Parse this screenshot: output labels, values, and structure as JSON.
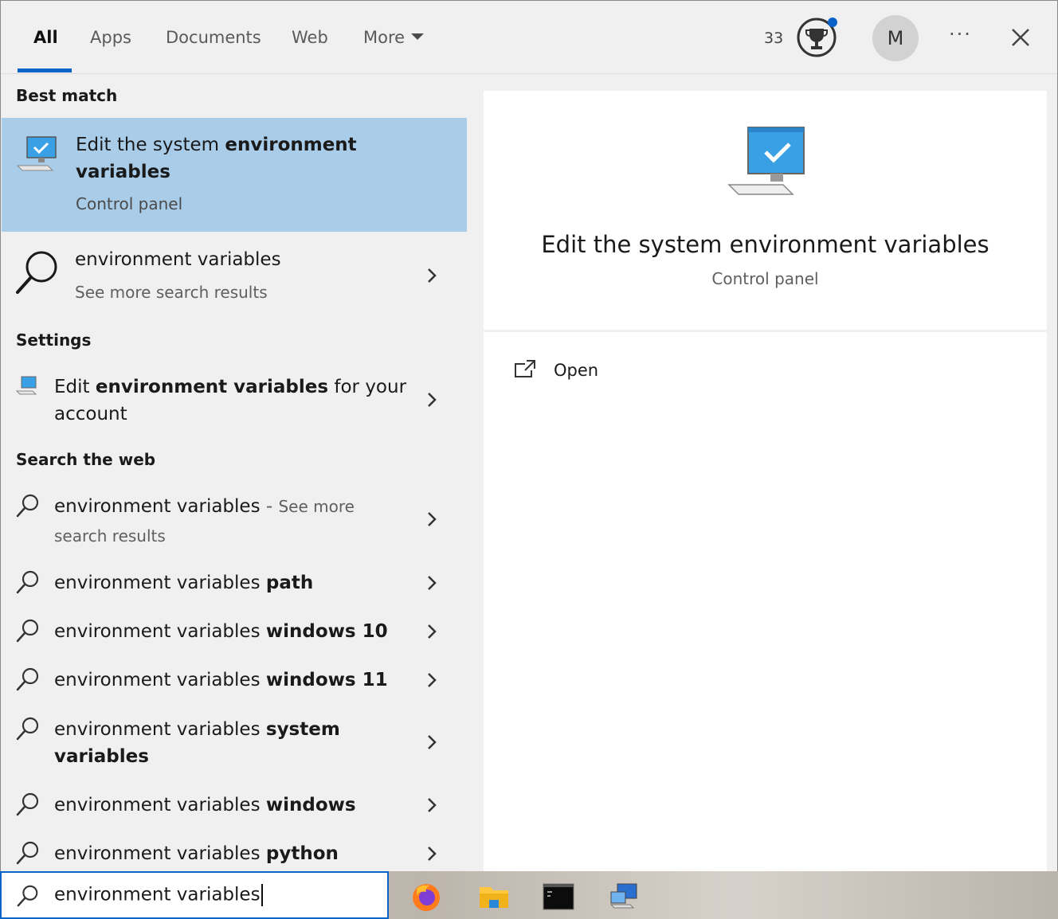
{
  "tabs": [
    {
      "label": "All"
    },
    {
      "label": "Apps"
    },
    {
      "label": "Documents"
    },
    {
      "label": "Web"
    },
    {
      "label": "More"
    }
  ],
  "header": {
    "points": "33",
    "avatar_letter": "M",
    "more_options": "···"
  },
  "sections": {
    "best_match": "Best match",
    "settings": "Settings",
    "search_web": "Search the web"
  },
  "best_match_item": {
    "title_plain": "Edit the system ",
    "title_bold1": "environment",
    "title_bold2": "variables",
    "subtitle": "Control panel"
  },
  "more_results": {
    "title": "environment variables",
    "subtitle": "See more search results"
  },
  "settings_item": {
    "pre": "Edit ",
    "bold": "environment variables",
    "post": " for your",
    "line2": "account"
  },
  "web_first": {
    "title": "environment variables",
    "dash": " - ",
    "see_more": "See more",
    "line2": "search results"
  },
  "web_suggestions": [
    {
      "plain": "environment variables ",
      "bold": "path"
    },
    {
      "plain": "environment variables ",
      "bold": "windows 10"
    },
    {
      "plain": "environment variables ",
      "bold": "windows 11"
    },
    {
      "plain": "environment variables ",
      "bold": "system",
      "line2": "variables"
    },
    {
      "plain": "environment variables ",
      "bold": "windows"
    },
    {
      "plain": "environment variables ",
      "bold": "python"
    }
  ],
  "preview": {
    "title": "Edit the system environment variables",
    "subtitle": "Control panel",
    "open_label": "Open"
  },
  "search": {
    "value": "environment variables"
  },
  "taskbar": [
    "firefox-icon",
    "file-explorer-icon",
    "terminal-icon",
    "remote-desktop-icon"
  ],
  "colors": {
    "accent": "#0a64c8",
    "selected_bg": "#a9cce9",
    "panel_bg": "#f0f0f0"
  }
}
